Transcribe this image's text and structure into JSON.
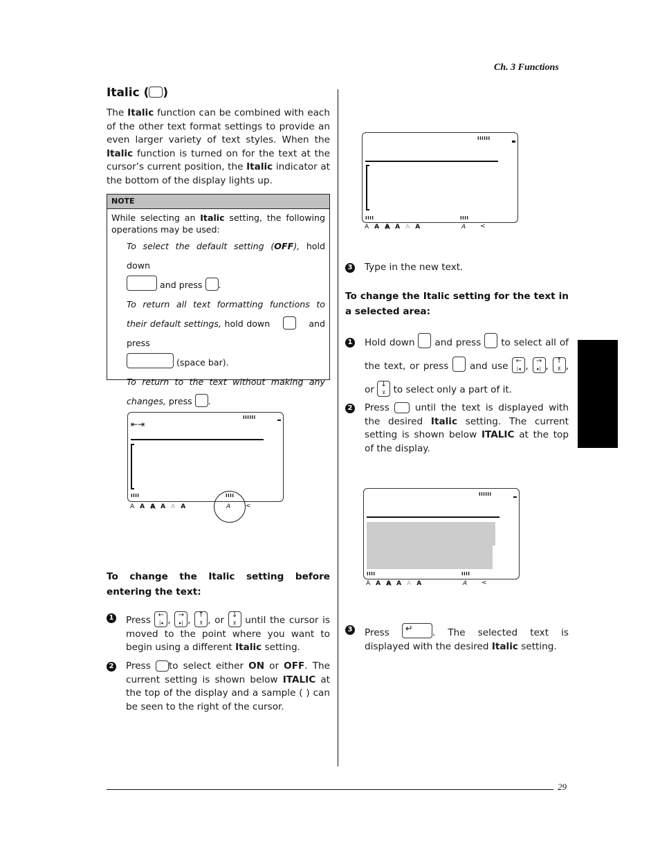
{
  "header": {
    "chapter": "Ch. 3 Functions"
  },
  "footer": {
    "page_number": "29"
  },
  "section": {
    "title": "Italic (",
    "title_close": ")",
    "intro": {
      "p1": "The ",
      "b1": "Italic",
      "p2": " function can be combined with each of the other text format settings to provide an even larger variety of text styles. When the ",
      "b2": "Italic",
      "p3": " function is turned on for the text at the cursor’s current position, the ",
      "b3": "Italic",
      "p4": " indicator at the bottom of the display lights up."
    }
  },
  "note": {
    "label": "NOTE",
    "intro_a": "While selecting an ",
    "intro_b": "Italic",
    "intro_c": " setting, the following operations may be used:",
    "op1_italic": "To select the default setting (",
    "op1_bold": "OFF",
    "op1_italic2": "),",
    "op1_rest": " hold down",
    "op1_and": "and press",
    "op1_end": ".",
    "op2_italic": "To return all text formatting functions to their default settings,",
    "op2_rest": " hold down",
    "op2_and": "and press",
    "op2_space": "(space bar).",
    "op3_italic": "To return to the text without making any changes,",
    "op3_rest": " press",
    "op3_end": "."
  },
  "display": {
    "indicator_glyphs": [
      "A",
      "A",
      "A",
      "A",
      "A",
      "A"
    ],
    "italic_glyph": "A",
    "arrow_glyph": "<",
    "ticks_top": "IIIIII",
    "ticks_bottom": "IIII",
    "tab_glyph": "⇤⇥"
  },
  "before_entering": {
    "heading": "To change the Italic setting before entering the text:",
    "step1": {
      "num": "1",
      "press": "Press",
      "sep1": ",",
      "sep2": ",",
      "or": ", or",
      "rest1": "until the cursor is moved to the point where you want to begin using a different ",
      "bold": "Italic",
      "rest2": " setting."
    },
    "step2": {
      "num": "2",
      "press": "Press",
      "a": "to select either ",
      "on": "ON",
      "or": " or ",
      "off": "OFF",
      "b": ". The current setting is shown below ",
      "italic_caps": "ITALIC",
      "c": " at the top of the display and a sample (   ) can be seen to the right of the cursor."
    },
    "step3": {
      "num": "3",
      "text": "Type in the new text."
    }
  },
  "selected_area": {
    "heading": "To change the Italic setting for the text in a selected area:",
    "step1": {
      "num": "1",
      "hold": "Hold down",
      "and_press": "and press",
      "select_all": "to select all of the text, or press",
      "and_use": "and use",
      "sep1": ",",
      "sep2": ",",
      "or": ", or",
      "rest": "to select only a part of it."
    },
    "step2": {
      "num": "2",
      "press": "Press",
      "a": " until the text is displayed with the desired ",
      "bold": "Italic",
      "b": " setting. The current setting is shown below ",
      "italic_caps": "ITALIC",
      "c": " at the top of the display."
    },
    "step3": {
      "num": "3",
      "press": "Press",
      "a": ". The selected text is displayed with the desired ",
      "bold": "Italic",
      "b": " setting."
    }
  },
  "keys": {
    "left": {
      "top": "←",
      "bottom": "|◂"
    },
    "right": {
      "top": "→",
      "bottom": "▸|"
    },
    "up": {
      "top": "↑",
      "bottom": "⊼"
    },
    "down": {
      "top": "↓",
      "bottom": "⊻"
    },
    "return": "↵"
  }
}
